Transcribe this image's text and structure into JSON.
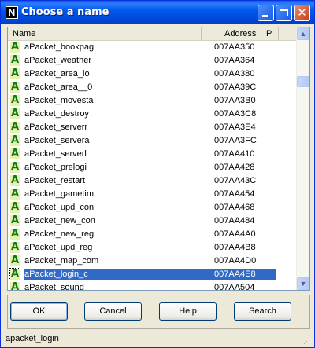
{
  "window": {
    "title": "Choose a name",
    "icon_letter": "N",
    "icon": "app-icon",
    "controls": {
      "minimize": "minimize-icon",
      "maximize": "maximize-icon",
      "close": "close-icon",
      "close_glyph": "✕"
    }
  },
  "list": {
    "columns": {
      "name": "Name",
      "address": "Address",
      "p": "P"
    },
    "row_icon_letter": "A",
    "items": [
      {
        "name": "aPacket_bookpag",
        "address": "007AA350"
      },
      {
        "name": "aPacket_weather",
        "address": "007AA364"
      },
      {
        "name": "aPacket_area_lo",
        "address": "007AA380"
      },
      {
        "name": "aPacket_area__0",
        "address": "007AA39C"
      },
      {
        "name": "aPacket_movesta",
        "address": "007AA3B0"
      },
      {
        "name": "aPacket_destroy",
        "address": "007AA3C8"
      },
      {
        "name": "aPacket_serverr",
        "address": "007AA3E4"
      },
      {
        "name": "aPacket_servera",
        "address": "007AA3FC"
      },
      {
        "name": "aPacket_serverl",
        "address": "007AA410"
      },
      {
        "name": "aPacket_prelogi",
        "address": "007AA428"
      },
      {
        "name": "aPacket_restart",
        "address": "007AA43C"
      },
      {
        "name": "aPacket_gametim",
        "address": "007AA454"
      },
      {
        "name": "aPacket_upd_con",
        "address": "007AA468"
      },
      {
        "name": "aPacket_new_con",
        "address": "007AA484"
      },
      {
        "name": "aPacket_new_reg",
        "address": "007AA4A0"
      },
      {
        "name": "aPacket_upd_reg",
        "address": "007AA4B8"
      },
      {
        "name": "aPacket_map_com",
        "address": "007AA4D0"
      },
      {
        "name": "aPacket_login_c",
        "address": "007AA4E8",
        "selected": true
      },
      {
        "name": "aPacket_sound",
        "address": "007AA504"
      }
    ],
    "scrollbar": {
      "up": "▲",
      "down": "▼"
    }
  },
  "buttons": {
    "ok": "OK",
    "cancel": "Cancel",
    "help": "Help",
    "search": "Search"
  },
  "status": {
    "text": "apacket_login"
  },
  "colors": {
    "titlebar": "#0058ee",
    "selection": "#316ac5",
    "dialog_bg": "#ece9d8"
  }
}
